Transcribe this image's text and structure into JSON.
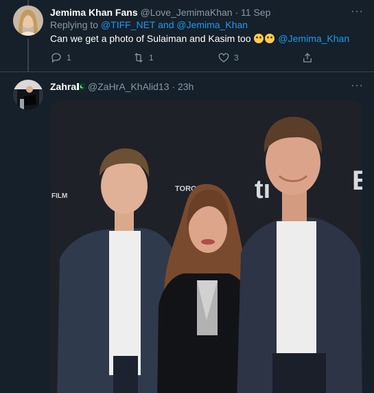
{
  "tweet1": {
    "name": "Jemima Khan Fans",
    "handle": "@Love_JemimaKhan",
    "separator": "·",
    "time": "11 Sep",
    "replying_prefix": "Replying to",
    "replying_user1": "@TIFF_NET",
    "replying_and": "and",
    "replying_user2": "@Jemima_Khan",
    "text": "Can we get a photo of Sulaiman and Kasim too",
    "mention": "@Jemima_Khan",
    "more": "···",
    "reply_count": "1",
    "retweet_count": "1",
    "like_count": "3"
  },
  "tweet2": {
    "name": "Zahra",
    "flag_icon": "pakistan-flag-icon",
    "handle": "@ZaHrA_KhAlid13",
    "separator": "·",
    "time": "23h",
    "more": "···"
  },
  "photo": {
    "backdrop_text_1": "TORONTO",
    "backdrop_text_2": "FILM"
  },
  "colors": {
    "background": "#15202b",
    "accent": "#1d9bf0",
    "secondary_text": "#8899a6",
    "divider": "#38444d"
  }
}
